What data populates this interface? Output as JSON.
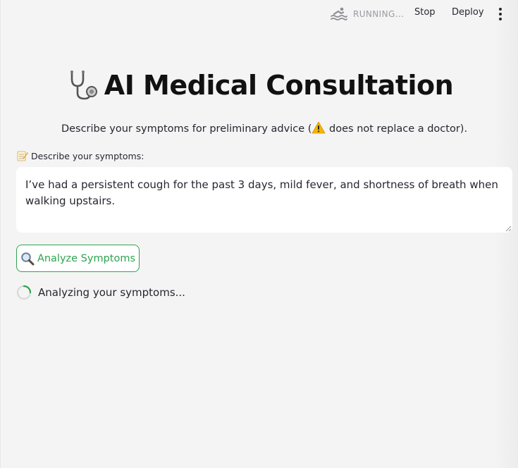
{
  "toolbar": {
    "running_label": "RUNNING...",
    "stop_label": "Stop",
    "deploy_label": "Deploy",
    "running_icon": "swimmer-icon",
    "menu_icon": "kebab-menu-icon"
  },
  "header": {
    "icon": "stethoscope-icon",
    "title": "AI Medical Consultation",
    "subtitle_before": "Describe your symptoms for preliminary advice (",
    "subtitle_warning_icon": "warning-icon",
    "subtitle_after": " does not replace a doctor)."
  },
  "form": {
    "label_icon": "memo-icon",
    "label": "Describe your symptoms:",
    "symptoms_value": "I’ve had a persistent cough for the past 3 days, mild fever, and shortness of breath when walking upstairs.",
    "analyze_icon": "magnifying-glass-icon",
    "analyze_label": "Analyze Symptoms"
  },
  "status": {
    "text": "Analyzing your symptoms..."
  },
  "colors": {
    "accent_green": "#2ea44f",
    "background": "#f4f4f4",
    "text": "#262730",
    "muted": "#9a9aa2"
  }
}
